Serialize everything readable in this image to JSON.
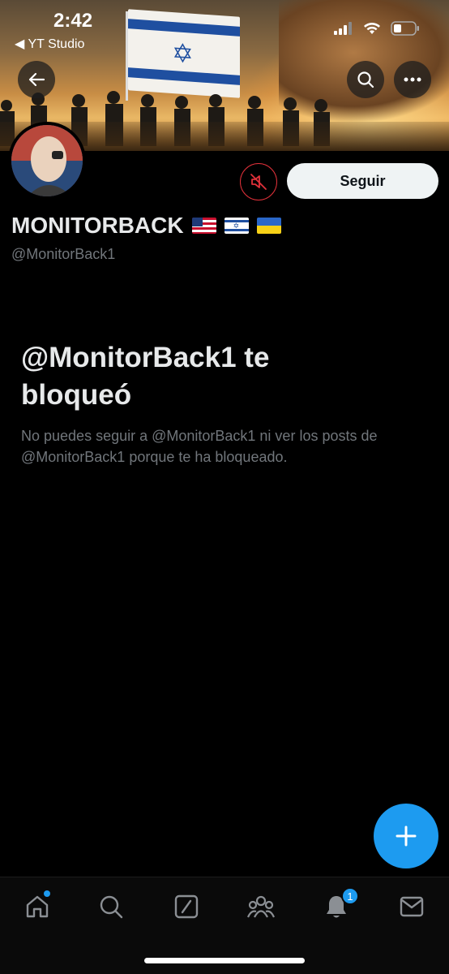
{
  "status_bar": {
    "time": "2:42",
    "back_app_label": "◀ YT Studio"
  },
  "profile": {
    "display_name": "MONITORBACK",
    "name_flags": [
      "us-flag",
      "israel-flag",
      "ukraine-flag"
    ],
    "handle": "@MonitorBack1",
    "follow_label": "Seguir"
  },
  "blocked": {
    "title": "@MonitorBack1 te bloqueó",
    "description": "No puedes seguir a @MonitorBack1 ni ver los posts de @MonitorBack1 porque te ha bloqueado."
  },
  "tabbar": {
    "items": [
      "home",
      "search",
      "grok",
      "communities",
      "notifications",
      "messages"
    ],
    "notifications_badge": "1"
  },
  "colors": {
    "accent": "#1d9bf0",
    "mute_red": "#e0313a",
    "background": "#000000"
  }
}
